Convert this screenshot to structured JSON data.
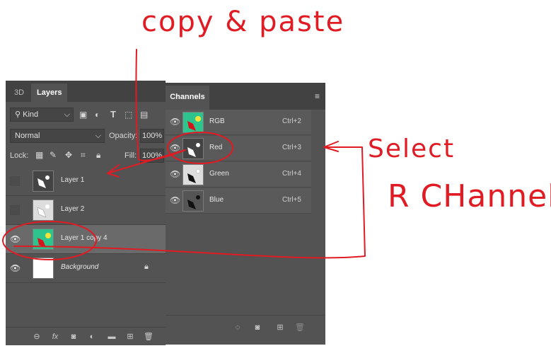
{
  "annotations": {
    "copy_paste": "copy & paste",
    "select": "Select",
    "r_channel": "R CHannel"
  },
  "layers_panel": {
    "tabs": [
      "3D",
      "Layers"
    ],
    "kind_label": "Kind",
    "blend_mode": "Normal",
    "opacity_label": "Opacity:",
    "opacity_value": "100%",
    "lock_label": "Lock:",
    "fill_label": "Fill:",
    "fill_value": "100%",
    "layers": [
      {
        "name": "Layer 1",
        "visible": false
      },
      {
        "name": "Layer 2",
        "visible": false
      },
      {
        "name": "Layer 1 copy 4",
        "visible": true,
        "selected": true
      },
      {
        "name": "Background",
        "visible": true,
        "locked": true
      }
    ]
  },
  "channels_panel": {
    "tab": "Channels",
    "channels": [
      {
        "name": "RGB",
        "shortcut": "Ctrl+2"
      },
      {
        "name": "Red",
        "shortcut": "Ctrl+3"
      },
      {
        "name": "Green",
        "shortcut": "Ctrl+4"
      },
      {
        "name": "Blue",
        "shortcut": "Ctrl+5"
      }
    ]
  },
  "colors": {
    "annotation_red": "#e01b24",
    "panel_bg": "#535353",
    "thumb_green": "#2ec48e"
  }
}
